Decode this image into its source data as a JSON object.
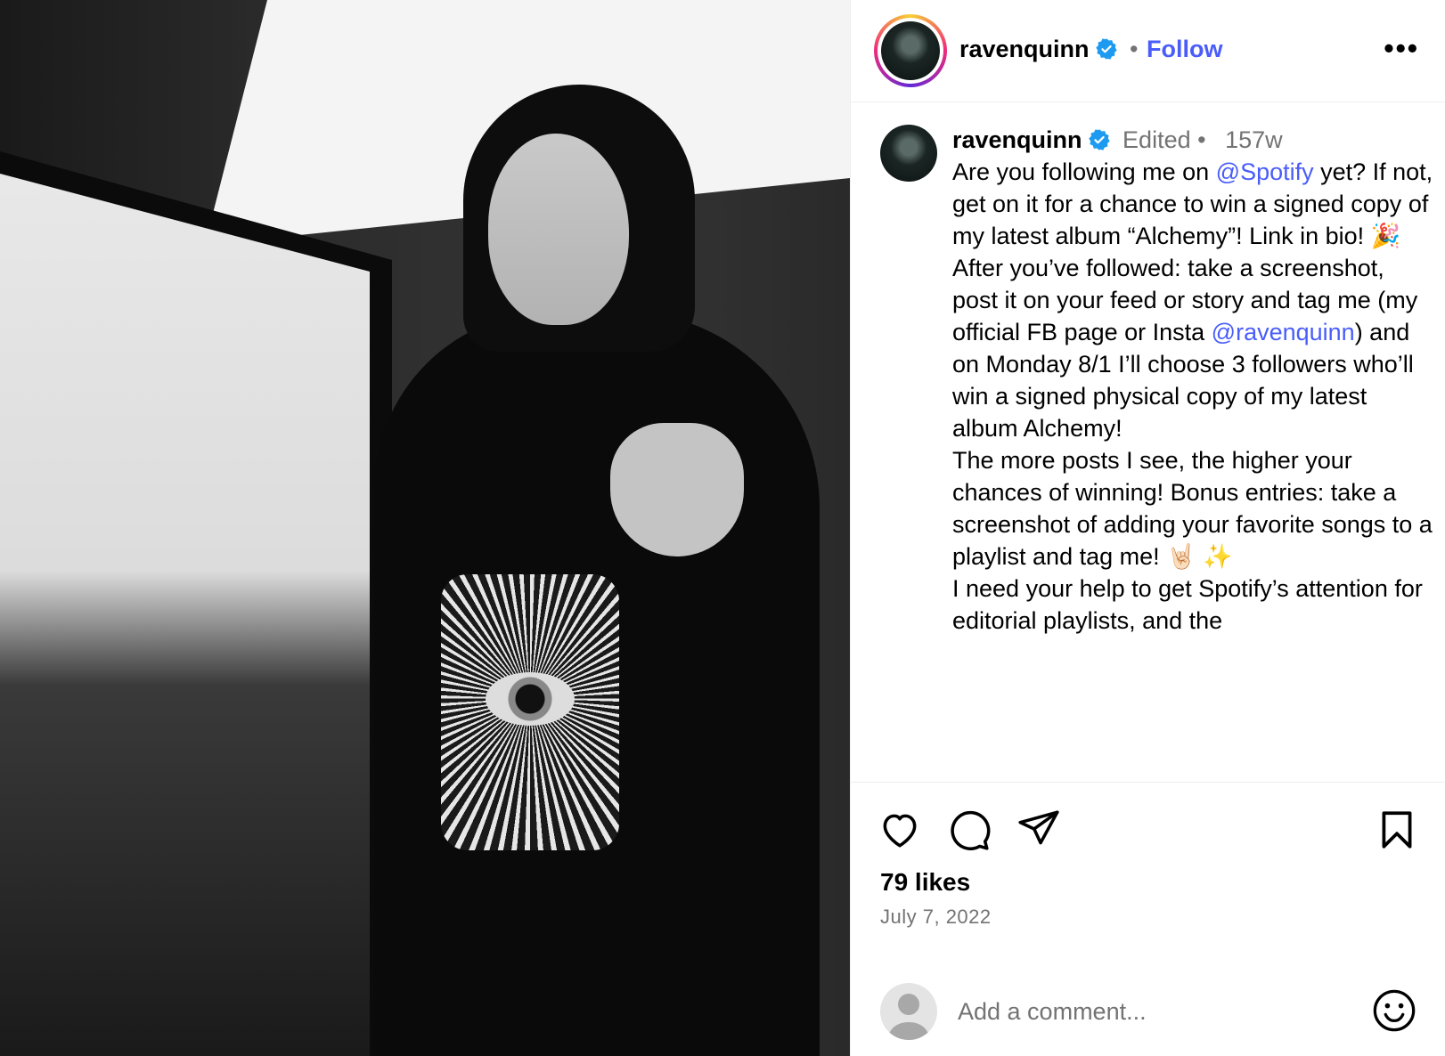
{
  "post": {
    "username": "ravenquinn",
    "follow_label": "Follow",
    "separator": "•",
    "more_label": "•••"
  },
  "caption": {
    "username": "ravenquinn",
    "edited": "Edited •",
    "age": "157w",
    "p1_a": "Are you following me on ",
    "p1_mention": "@Spotify",
    "p1_b": " yet? If not, get on it for a chance to win a signed copy of my latest album “Alchemy”! Link in bio! 🎉",
    "p2_a": "After you’ve followed: take a screenshot, post it on your feed or story and tag me (my official FB page or Insta ",
    "p2_mention": "@ravenquinn",
    "p2_b": ") and on Monday 8/1 I’ll choose 3 followers who’ll win a signed physical copy of my latest album Alchemy!",
    "p3": "The more posts I see, the higher your chances of winning! Bonus entries: take a screenshot of adding your favorite songs to a playlist and tag me! 🤘🏻 ✨",
    "p4": "I need your help to get Spotify’s attention for editorial playlists, and the"
  },
  "engagement": {
    "likes": "79 likes",
    "date": "July 7, 2022"
  },
  "comment": {
    "placeholder": "Add a comment..."
  },
  "icons": {
    "like": "heart-icon",
    "comment": "speech-bubble-icon",
    "share": "paper-plane-icon",
    "save": "bookmark-icon",
    "emoji": "smiley-icon",
    "verified": "verified-badge-icon",
    "verified_color": "#1d9bf0",
    "link_color": "#4a5df9"
  }
}
